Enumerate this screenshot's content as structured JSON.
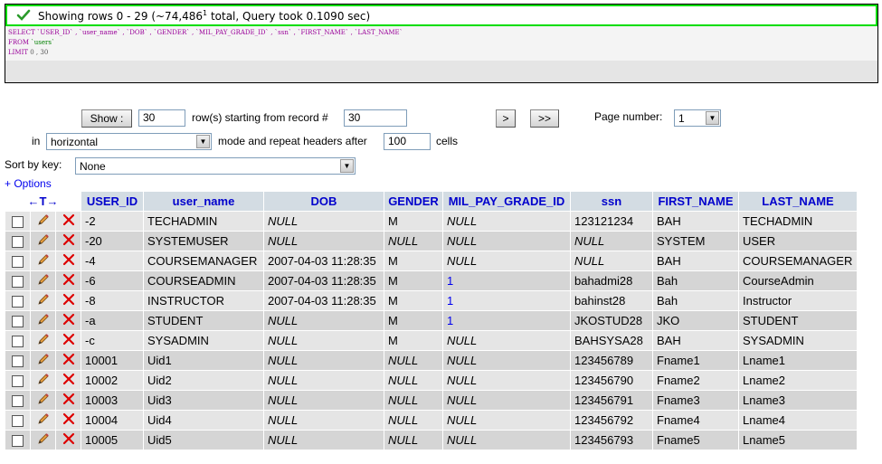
{
  "status": {
    "message": "Showing rows 0 - 29 (~74,486",
    "sup": "1",
    "message_tail": " total, Query took 0.1090 sec)"
  },
  "sql": {
    "line1": "SELECT `USER_ID` , `user_name` , `DOB` , `GENDER` , `MIL_PAY_GRADE_ID` , `ssn` , `FIRST_NAME` , `LAST_NAME`",
    "line2_kw": "FROM",
    "line2_str": "`users`",
    "line3_kw": "LIMIT",
    "line3_val": "0 , 30"
  },
  "nav": {
    "show_label": "Show :",
    "rows_value": "30",
    "rows_text": "row(s) starting from record #",
    "start_value": "30",
    "next_label": ">",
    "last_label": ">>",
    "page_label": "Page number:",
    "page_value": "1",
    "in_label": "in",
    "mode_value": "horizontal",
    "repeat_text": "mode and repeat headers after",
    "repeat_value": "100",
    "cells_text": "cells",
    "sort_label": "Sort by key:",
    "sort_value": "None",
    "options_link": "+ Options"
  },
  "table": {
    "arrows": "←T→",
    "headers": [
      "USER_ID",
      "user_name",
      "DOB",
      "GENDER",
      "MIL_PAY_GRADE_ID",
      "ssn",
      "FIRST_NAME",
      "LAST_NAME"
    ],
    "rows": [
      [
        "-2",
        "TECHADMIN",
        "NULL",
        "M",
        "NULL",
        "123121234",
        "BAH",
        "TECHADMIN"
      ],
      [
        "-20",
        "SYSTEMUSER",
        "NULL",
        "NULL",
        "NULL",
        "NULL",
        "SYSTEM",
        "USER"
      ],
      [
        "-4",
        "COURSEMANAGER",
        "2007-04-03 11:28:35",
        "M",
        "NULL",
        "NULL",
        "BAH",
        "COURSEMANAGER"
      ],
      [
        "-6",
        "COURSEADMIN",
        "2007-04-03 11:28:35",
        "M",
        "1",
        "bahadmi28",
        "Bah",
        "CourseAdmin"
      ],
      [
        "-8",
        "INSTRUCTOR",
        "2007-04-03 11:28:35",
        "M",
        "1",
        "bahinst28",
        "Bah",
        "Instructor"
      ],
      [
        "-a",
        "STUDENT",
        "NULL",
        "M",
        "1",
        "JKOSTUD28",
        "JKO",
        "STUDENT"
      ],
      [
        "-c",
        "SYSADMIN",
        "NULL",
        "M",
        "NULL",
        "BAHSYSA28",
        "BAH",
        "SYSADMIN"
      ],
      [
        "10001",
        "Uid1",
        "NULL",
        "NULL",
        "NULL",
        "123456789",
        "Fname1",
        "Lname1"
      ],
      [
        "10002",
        "Uid2",
        "NULL",
        "NULL",
        "NULL",
        "123456790",
        "Fname2",
        "Lname2"
      ],
      [
        "10003",
        "Uid3",
        "NULL",
        "NULL",
        "NULL",
        "123456791",
        "Fname3",
        "Lname3"
      ],
      [
        "10004",
        "Uid4",
        "NULL",
        "NULL",
        "NULL",
        "123456792",
        "Fname4",
        "Lname4"
      ],
      [
        "10005",
        "Uid5",
        "NULL",
        "NULL",
        "NULL",
        "123456793",
        "Fname5",
        "Lname5"
      ]
    ]
  },
  "colors": {
    "success_border": "#00dd00",
    "header_bg": "#d3dce3",
    "header_text": "#0000cc",
    "row_odd": "#e5e5e5",
    "row_even": "#d5d5d5",
    "link": "#0000ee"
  },
  "icons": {
    "status": "check-icon",
    "edit": "pencil-icon",
    "delete": "delete-x-icon"
  }
}
